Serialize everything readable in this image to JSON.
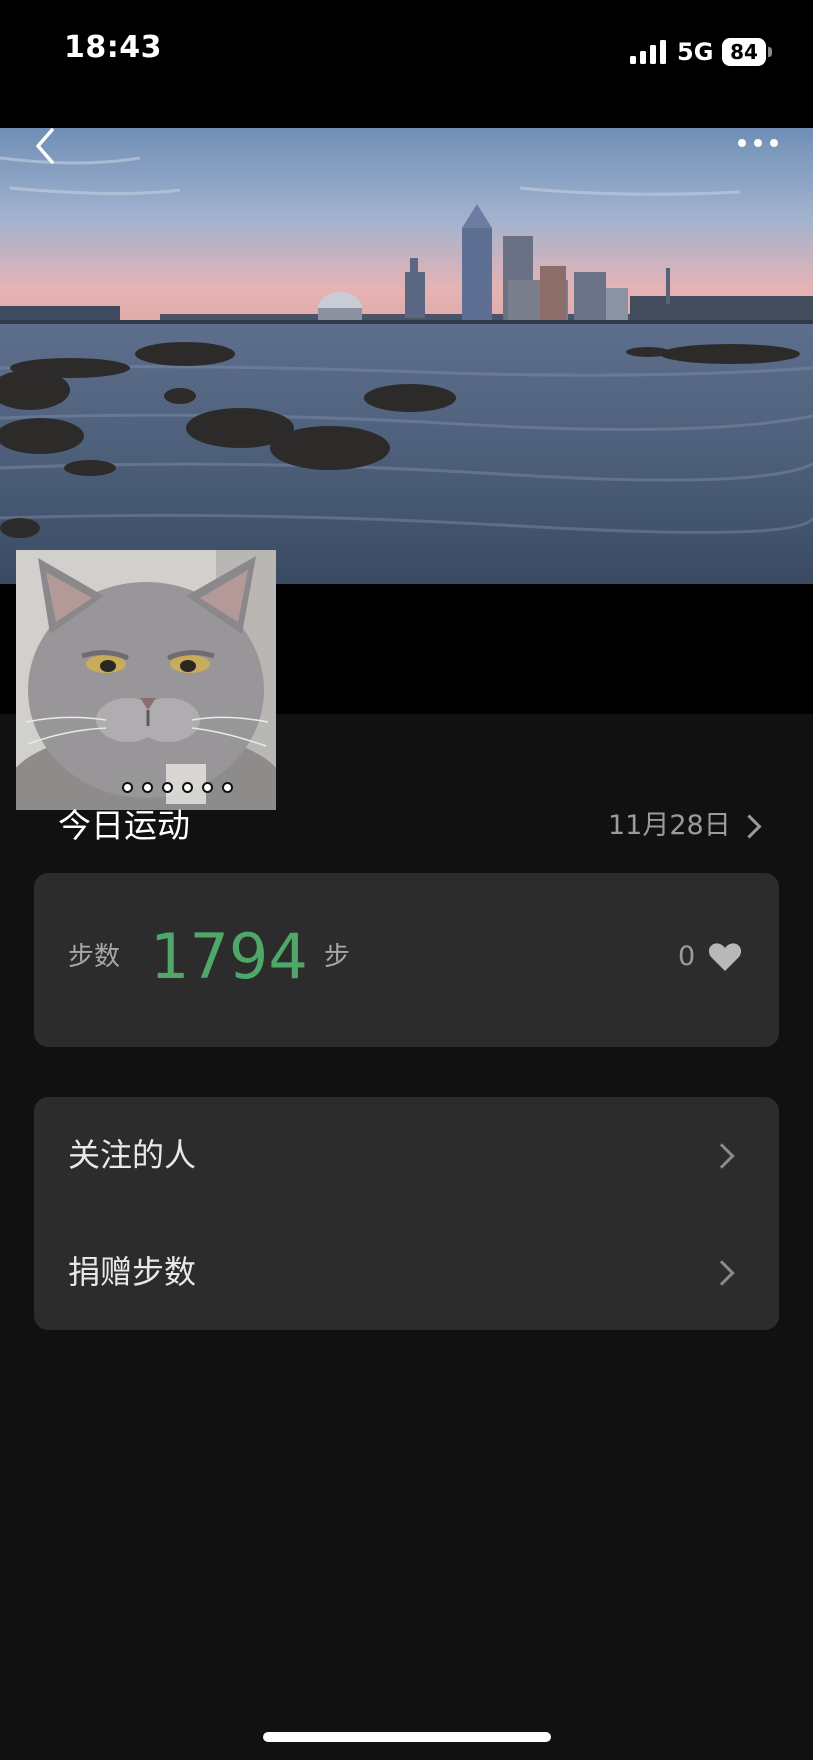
{
  "status_bar": {
    "time": "18:43",
    "network": "5G",
    "battery": "84"
  },
  "icons": {
    "back": "chevron-left-icon",
    "more": "ellipsis-icon",
    "signal": "cellular-signal-icon",
    "battery": "battery-icon",
    "heart": "heart-icon",
    "chevron": "chevron-right-icon"
  },
  "colors": {
    "steps_value": "#4fa86a",
    "card_background": "#2c2c2c",
    "page_background": "#111111"
  },
  "today": {
    "title": "今日运动",
    "date": "11月28日"
  },
  "steps": {
    "label": "步数",
    "value": "1794",
    "unit": "步",
    "likes": "0"
  },
  "menu": {
    "items": [
      {
        "label": "关注的人"
      },
      {
        "label": "捐赠步数"
      }
    ]
  }
}
